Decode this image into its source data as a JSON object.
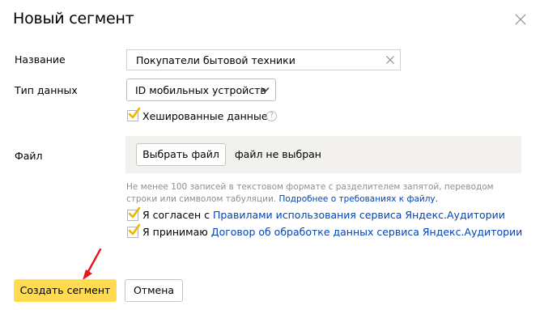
{
  "dialog": {
    "title": "Новый сегмент"
  },
  "form": {
    "name_label": "Название",
    "name_value": "Покупатели бытовой техники",
    "type_label": "Тип данных",
    "type_value": "ID мобильных устройств",
    "hashed_label": "Хешированные данные",
    "hashed_checked": true,
    "help_symbol": "?",
    "file_label": "Файл",
    "file_button": "Выбрать файл",
    "file_status": "файл не выбран",
    "hint_text": "Не менее 100 записей в текстовом формате с разделителем запятой, переводом строки или символом табуляции.",
    "hint_link": "Подробнее о требованиях к файлу.",
    "agree_prefix": "Я согласен с",
    "agree_link": "Правилами использования сервиса Яндекс.Аудитории",
    "agree_checked": true,
    "accept_prefix": "Я принимаю",
    "accept_link": "Договор об обработке данных сервиса Яндекс.Аудитории",
    "accept_checked": true
  },
  "buttons": {
    "create": "Создать сегмент",
    "cancel": "Отмена"
  },
  "colors": {
    "primary_button": "#ffdb4d",
    "link": "#0044bb",
    "checkmark": "#e8b700",
    "annotation_arrow": "#e8161a"
  }
}
